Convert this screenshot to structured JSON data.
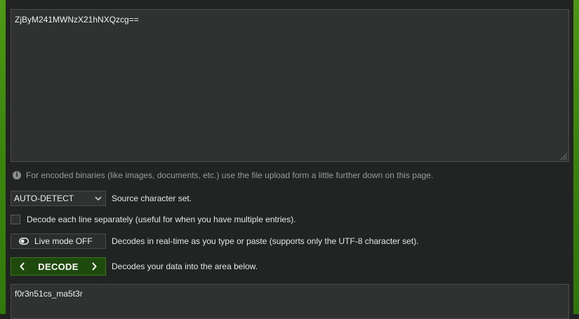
{
  "input": {
    "value": "ZjByM241MWNzX21hNXQzcg=="
  },
  "hint": {
    "text": "For encoded binaries (like images, documents, etc.) use the file upload form a little further down on this page."
  },
  "charset": {
    "selected": "AUTO-DETECT",
    "label": "Source character set."
  },
  "each_line": {
    "checked": false,
    "label": "Decode each line separately (useful for when you have multiple entries)."
  },
  "live_mode": {
    "button_label": "Live mode OFF",
    "description": "Decodes in real-time as you type or paste (supports only the UTF-8 character set)."
  },
  "decode": {
    "button_label": "DECODE",
    "description": "Decodes your data into the area below."
  },
  "output": {
    "value": "f0r3n51cs_ma5t3r"
  },
  "colors": {
    "accent_green": "#1f4a0e",
    "edge_green": "#3d8710",
    "panel": "#222323",
    "field": "#303131"
  },
  "icons": [
    "info-icon",
    "chevron-down-icon",
    "toggle-icon",
    "chevron-left-icon",
    "chevron-right-icon",
    "resize-grip-icon"
  ]
}
